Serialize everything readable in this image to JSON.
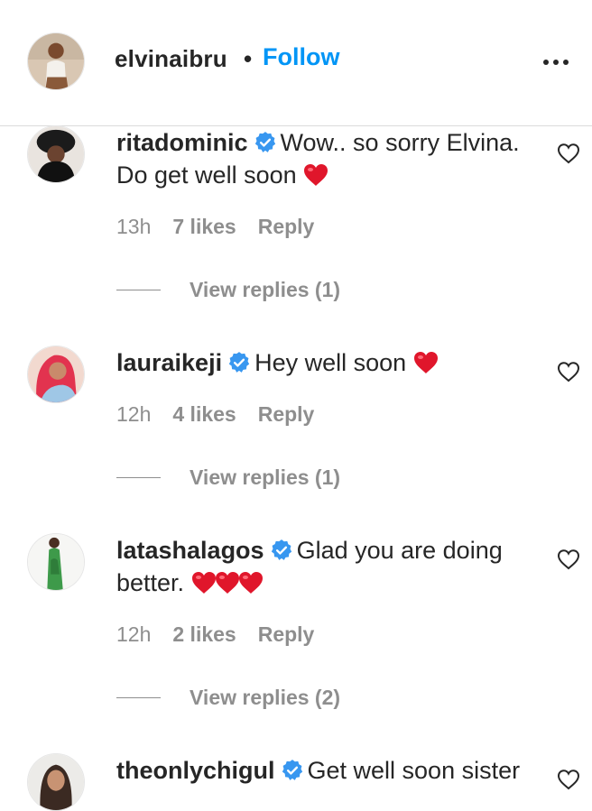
{
  "header": {
    "username": "elvinaibru",
    "separator": "•",
    "follow_label": "Follow",
    "more_icon": "more-horizontal-icon"
  },
  "comments": [
    {
      "username": "ritadominic",
      "verified": true,
      "text": "Wow.. so sorry Elvina. Do get well soon",
      "emoji": [
        "❤️"
      ],
      "time": "13h",
      "likes": "7 likes",
      "reply_label": "Reply",
      "view_replies": "View replies (1)"
    },
    {
      "username": "lauraikeji",
      "verified": true,
      "text": "Hey well soon",
      "emoji": [
        "❤️"
      ],
      "time": "12h",
      "likes": "4 likes",
      "reply_label": "Reply",
      "view_replies": "View replies (1)"
    },
    {
      "username": "latashalagos",
      "verified": true,
      "text": "Glad you are doing better.",
      "emoji": [
        "❤️",
        "❤️",
        "❤️"
      ],
      "time": "12h",
      "likes": "2 likes",
      "reply_label": "Reply",
      "view_replies": "View replies (2)"
    },
    {
      "username": "theonlychigul",
      "verified": true,
      "text": "Get well soon sister",
      "emoji": []
    }
  ],
  "colors": {
    "text": "#262626",
    "secondary": "#8e8e8e",
    "link_blue": "#0095f6",
    "verified_blue": "#3897f0",
    "heart_red": "#e0162b",
    "divider": "#dbdbdb"
  }
}
